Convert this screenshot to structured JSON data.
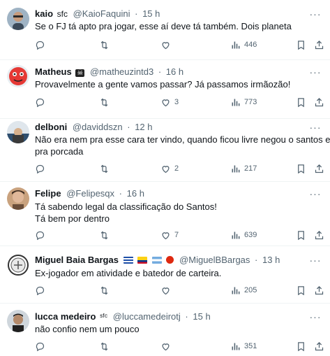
{
  "replies": [
    {
      "name": "kaio",
      "badge": "ѕfс",
      "handle": "@KaioFaquini",
      "time": "15 h",
      "lines": [
        "Se o FJ tá apto pra jogar, esse aí deve tá também. Dois planeta"
      ],
      "replies": "",
      "retweets": "",
      "likes": "",
      "views": "446"
    },
    {
      "name": "Matheus",
      "badge": "☠",
      "handle": "@matheuzintd3",
      "time": "16 h",
      "lines": [
        "Provavelmente a gente vamos passar? Já passamos irmãozão!"
      ],
      "replies": "",
      "retweets": "",
      "likes": "3",
      "views": "773"
    },
    {
      "name": "delboni",
      "badge": "",
      "handle": "@daviddszn",
      "time": "12 h",
      "lines": [
        "Não era nem pra esse cara ter vindo, quando ficou livre negou o santos e foi",
        "pra porcada"
      ],
      "replies": "",
      "retweets": "",
      "likes": "2",
      "views": "217"
    },
    {
      "name": "Felipe",
      "badge": "",
      "handle": "@Felipesqx",
      "time": "16 h",
      "lines": [
        "Tá sabendo legal da classificação do Santos!",
        "Tá bem por dentro"
      ],
      "replies": "",
      "retweets": "",
      "likes": "7",
      "views": "639"
    },
    {
      "name": "Miguel Baia Bargas",
      "badge": "",
      "handle": "@MiguelBBargas",
      "time": "13 h",
      "lines": [
        "Ex-jogador em atividade e batedor de carteira."
      ],
      "replies": "",
      "retweets": "",
      "likes": "",
      "views": "205"
    },
    {
      "name": "lucca medeiro",
      "badge": "ˢᶠᶜ",
      "handle": "@luccamedeirotj",
      "time": "15 h",
      "lines": [
        "não confio nem um pouco"
      ],
      "replies": "",
      "retweets": "",
      "likes": "",
      "views": "351"
    }
  ],
  "icons": {
    "reply": "reply-icon",
    "retweet": "retweet-icon",
    "like": "like-icon",
    "views": "views-icon",
    "bookmark": "bookmark-icon",
    "share": "share-icon",
    "more": "more-options-icon"
  },
  "colors": {
    "text": "#0f1419",
    "secondary": "#536471",
    "divider": "#eff3f4"
  }
}
